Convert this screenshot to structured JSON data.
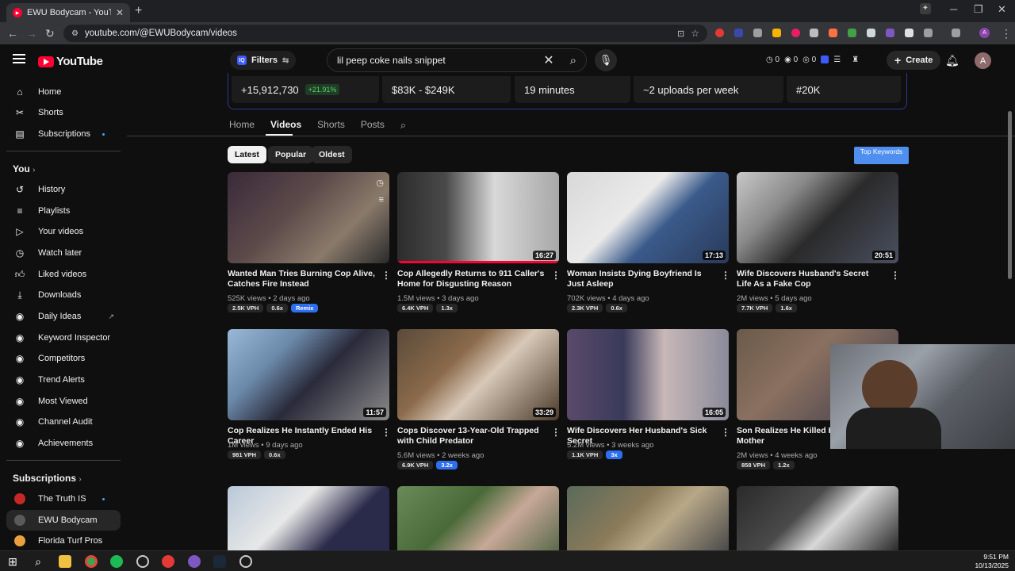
{
  "browser": {
    "tab_title": "EWU Bodycam - YouTube",
    "url": "youtube.com/@EWUBodycam/videos"
  },
  "header": {
    "logo_text": "YouTube",
    "filters_label": "Filters",
    "search_query": "lil peep coke nails snippet",
    "mini_stats": [
      "0",
      "0",
      "0"
    ],
    "create_label": "Create",
    "avatar_letter": "A"
  },
  "sidebar": {
    "main": [
      {
        "label": "Home",
        "icon": "home-icon"
      },
      {
        "label": "Shorts",
        "icon": "shorts-icon"
      },
      {
        "label": "Subscriptions",
        "icon": "subscriptions-icon"
      }
    ],
    "you_heading": "You",
    "you_items": [
      {
        "label": "History",
        "icon": "history-icon"
      },
      {
        "label": "Playlists",
        "icon": "playlists-icon"
      },
      {
        "label": "Your videos",
        "icon": "your-videos-icon"
      },
      {
        "label": "Watch later",
        "icon": "watch-later-icon"
      },
      {
        "label": "Liked videos",
        "icon": "like-icon"
      },
      {
        "label": "Downloads",
        "icon": "download-icon"
      }
    ],
    "tool_items": [
      {
        "label": "Daily Ideas",
        "icon": "daily-ideas-icon"
      },
      {
        "label": "Keyword Inspector",
        "icon": "keyword-inspector-icon"
      },
      {
        "label": "Competitors",
        "icon": "competitors-icon"
      },
      {
        "label": "Trend Alerts",
        "icon": "trend-alerts-icon"
      },
      {
        "label": "Most Viewed",
        "icon": "most-viewed-icon"
      },
      {
        "label": "Channel Audit",
        "icon": "channel-audit-icon"
      },
      {
        "label": "Achievements",
        "icon": "achievements-icon"
      }
    ],
    "subs_heading": "Subscriptions",
    "subs": [
      {
        "label": "The Truth IS",
        "color": "#c62828"
      },
      {
        "label": "EWU Bodycam",
        "color": "#5a5a5a"
      },
      {
        "label": "Florida Turf Pros",
        "color": "#e8a040"
      }
    ]
  },
  "channel_stats": {
    "subs_gain": "+15,912,730",
    "subs_gain_pct": "+21.91%",
    "earnings": "$83K - $249K",
    "avg_length": "19 minutes",
    "upload_freq": "~2 uploads per week",
    "rank": "#20K"
  },
  "channel_tabs": [
    "Home",
    "Videos",
    "Shorts",
    "Posts"
  ],
  "sort_chips": [
    "Latest",
    "Popular",
    "Oldest"
  ],
  "top_keywords_label": "Top Keywords",
  "videos": [
    {
      "title": "Wanted Man Tries Burning Cop Alive, Catches Fire Instead",
      "views": "525K views",
      "age": "2 days ago",
      "vph": "2.5K VPH",
      "mult": "0.6x",
      "extra": "Remix",
      "duration": ""
    },
    {
      "title": "Cop Allegedly Returns to 911 Caller's Home for Disgusting Reason",
      "views": "1.5M views",
      "age": "3 days ago",
      "vph": "6.4K VPH",
      "mult": "1.3x",
      "duration": "16:27"
    },
    {
      "title": "Woman Insists Dying Boyfriend Is Just Asleep",
      "views": "702K views",
      "age": "4 days ago",
      "vph": "2.3K VPH",
      "mult": "0.6x",
      "duration": "17:13"
    },
    {
      "title": "Wife Discovers Husband's Secret Life As a Fake Cop",
      "views": "2M views",
      "age": "5 days ago",
      "vph": "7.7K VPH",
      "mult": "1.6x",
      "duration": "20:51"
    },
    {
      "title": "Cop Realizes He Instantly Ended His Career",
      "views": "1M views",
      "age": "9 days ago",
      "vph": "981 VPH",
      "mult": "0.6x",
      "duration": "11:57"
    },
    {
      "title": "Cops Discover 13-Year-Old Trapped with Child Predator",
      "views": "5.6M views",
      "age": "2 weeks ago",
      "vph": "6.9K VPH",
      "mult": "3.2x",
      "duration": "33:29"
    },
    {
      "title": "Wife Discovers Her Husband's Sick Secret",
      "views": "5.2M views",
      "age": "3 weeks ago",
      "vph": "1.1K VPH",
      "mult": "3x",
      "duration": "16:05"
    },
    {
      "title": "Son Realizes He Killed His 9",
      "title2": "Mother",
      "views": "2M views",
      "age": "4 weeks ago",
      "vph": "858 VPH",
      "mult": "1.2x",
      "duration": ""
    }
  ],
  "taskbar": {
    "time": "9:51 PM",
    "date": "10/13/2025"
  }
}
